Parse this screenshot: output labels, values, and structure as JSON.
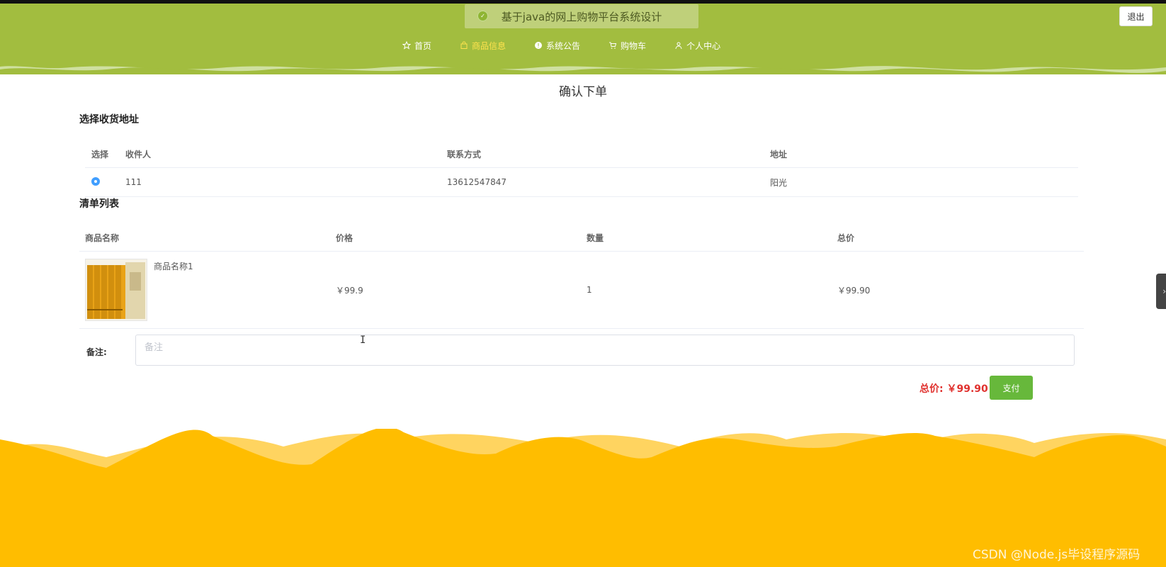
{
  "header": {
    "site_title": "基于java的网上购物平台系统设计",
    "logout_label": "退出",
    "nav": [
      {
        "label": "首页",
        "icon": "star-icon",
        "active": false
      },
      {
        "label": "商品信息",
        "icon": "bag-icon",
        "active": true
      },
      {
        "label": "系统公告",
        "icon": "info-icon",
        "active": false
      },
      {
        "label": "购物车",
        "icon": "cart-icon",
        "active": false
      },
      {
        "label": "个人中心",
        "icon": "user-icon",
        "active": false
      }
    ]
  },
  "page": {
    "heading": "确认下单",
    "address_section_title": "选择收货地址",
    "address_table": {
      "headers": [
        "选择",
        "收件人",
        "联系方式",
        "地址"
      ],
      "rows": [
        {
          "selected": true,
          "recipient": "111",
          "phone": "13612547847",
          "address": "阳光"
        }
      ]
    },
    "goods_section_title": "清单列表",
    "goods_table": {
      "headers": [
        "商品名称",
        "价格",
        "数量",
        "总价"
      ],
      "rows": [
        {
          "name": "商品名称1",
          "price": "￥99.9",
          "quantity": "1",
          "total": "￥99.90"
        }
      ]
    },
    "remark_label": "备注:",
    "remark_placeholder": "备注",
    "remark_value": "",
    "total_label": "总价: ",
    "total_value": "￥99.90",
    "pay_label": "支付",
    "side_handle_glyph": "›"
  },
  "watermark": "CSDN @Node.js毕设程序源码",
  "colors": {
    "header_green": "#a2bd3f",
    "nav_active": "#ffe34d",
    "footer_yellow": "#ffbd00",
    "total_red": "#e0322f",
    "pay_green": "#67b83b",
    "radio_blue": "#409eff"
  }
}
